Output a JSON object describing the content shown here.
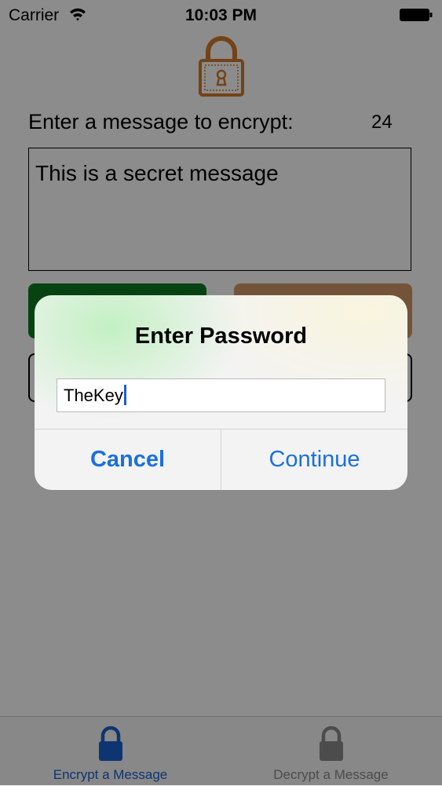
{
  "status_bar": {
    "carrier": "Carrier",
    "time": "10:03 PM"
  },
  "main": {
    "prompt": "Enter a message to encrypt:",
    "char_count": "24",
    "message": "This is a secret message"
  },
  "alert": {
    "title": "Enter Password",
    "password_value": "TheKey",
    "cancel_label": "Cancel",
    "continue_label": "Continue"
  },
  "tab_bar": {
    "tabs": [
      {
        "label": "Encrypt a Message",
        "icon": "lock-icon",
        "selected": true
      },
      {
        "label": "Decrypt a Message",
        "icon": "lock-icon",
        "selected": false
      }
    ]
  },
  "colors": {
    "accent": "#1b6fe0",
    "lock_logo": "#d17a2a",
    "encrypt_button": "#0e7a22",
    "decrypt_button": "#d29a6c"
  }
}
